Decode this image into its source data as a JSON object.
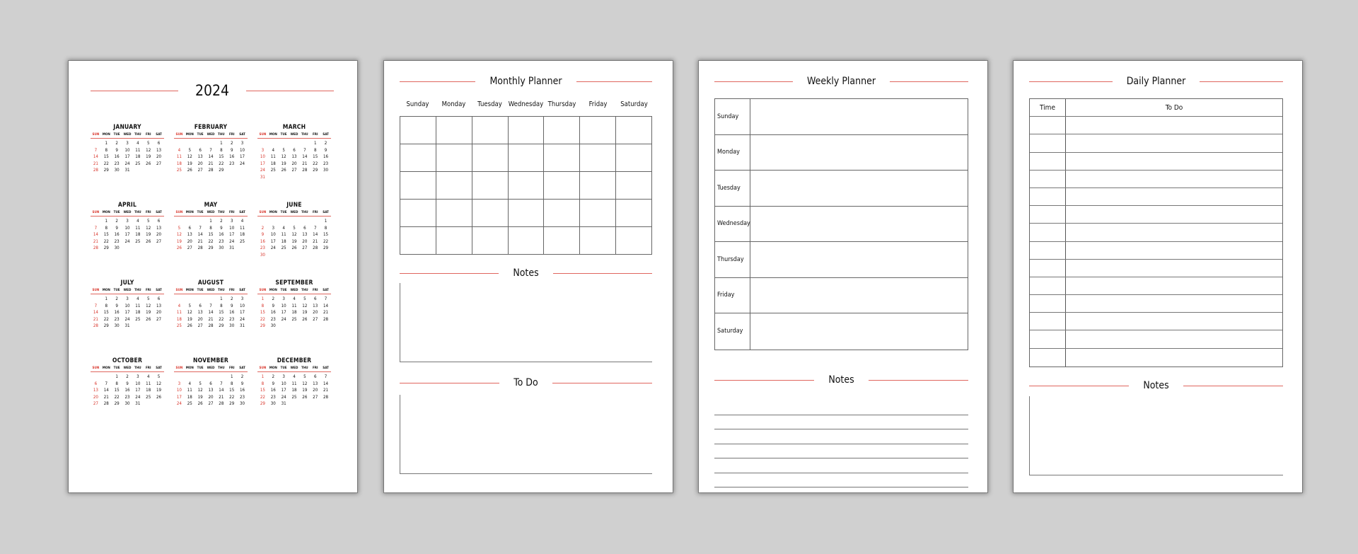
{
  "colors": {
    "accent": "#e0665e",
    "sunday": "#d8342a",
    "background": "#d0d0d0"
  },
  "calendar": {
    "year": "2024",
    "dow": [
      "SUN",
      "MON",
      "TUE",
      "WED",
      "THU",
      "FRI",
      "SAT"
    ],
    "months": [
      {
        "name": "JANUARY",
        "start": 1,
        "days": 31
      },
      {
        "name": "FEBRUARY",
        "start": 4,
        "days": 29
      },
      {
        "name": "MARCH",
        "start": 5,
        "days": 31
      },
      {
        "name": "APRIL",
        "start": 1,
        "days": 30
      },
      {
        "name": "MAY",
        "start": 3,
        "days": 31
      },
      {
        "name": "JUNE",
        "start": 6,
        "days": 30
      },
      {
        "name": "JULY",
        "start": 1,
        "days": 31
      },
      {
        "name": "AUGUST",
        "start": 4,
        "days": 31
      },
      {
        "name": "SEPTEMBER",
        "start": 0,
        "days": 30
      },
      {
        "name": "OCTOBER",
        "start": 2,
        "days": 31
      },
      {
        "name": "NOVEMBER",
        "start": 5,
        "days": 30
      },
      {
        "name": "DECEMBER",
        "start": 0,
        "days": 31
      }
    ]
  },
  "monthly": {
    "title": "Monthly Planner",
    "days": [
      "Sunday",
      "Monday",
      "Tuesday",
      "Wednesday",
      "Thursday",
      "Friday",
      "Saturday"
    ],
    "notes_title": "Notes",
    "todo_title": "To Do"
  },
  "weekly": {
    "title": "Weekly Planner",
    "days": [
      "Sunday",
      "Monday",
      "Tuesday",
      "Wednesday",
      "Thursday",
      "Friday",
      "Saturday"
    ],
    "notes_title": "Notes"
  },
  "daily": {
    "title": "Daily Planner",
    "col_time": "Time",
    "col_todo": "To Do",
    "rows": 14,
    "notes_title": "Notes"
  }
}
